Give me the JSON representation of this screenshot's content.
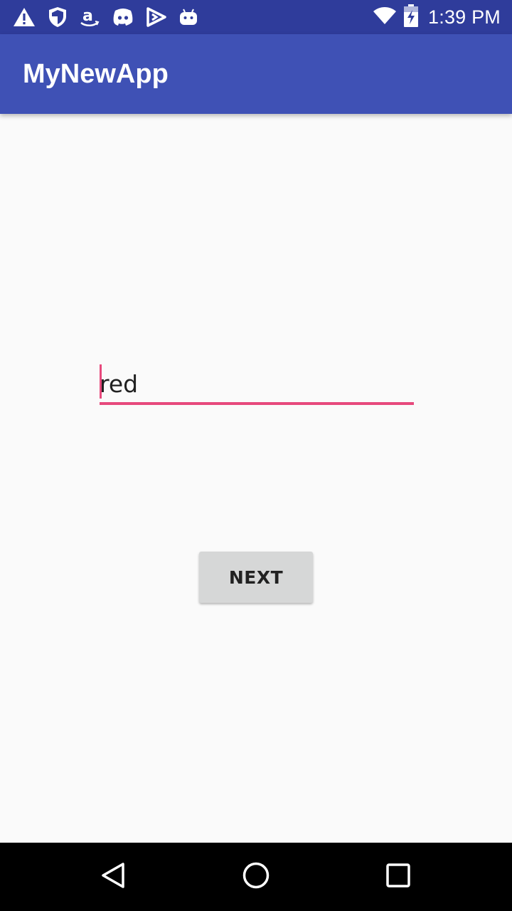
{
  "status_bar": {
    "time": "1:39 PM",
    "icons_left": [
      "warning-icon",
      "shield-icon",
      "amazon-icon",
      "discord-icon",
      "play-store-icon",
      "android-icon"
    ],
    "icons_right": [
      "wifi-icon",
      "battery-charging-icon"
    ]
  },
  "app_bar": {
    "title": "MyNewApp",
    "color": "#3f51b5"
  },
  "form": {
    "input_value": "red",
    "accent_color": "#e7497c",
    "next_label": "NEXT"
  },
  "nav_bar": {
    "icons": [
      "back-icon",
      "home-icon",
      "recents-icon"
    ]
  }
}
